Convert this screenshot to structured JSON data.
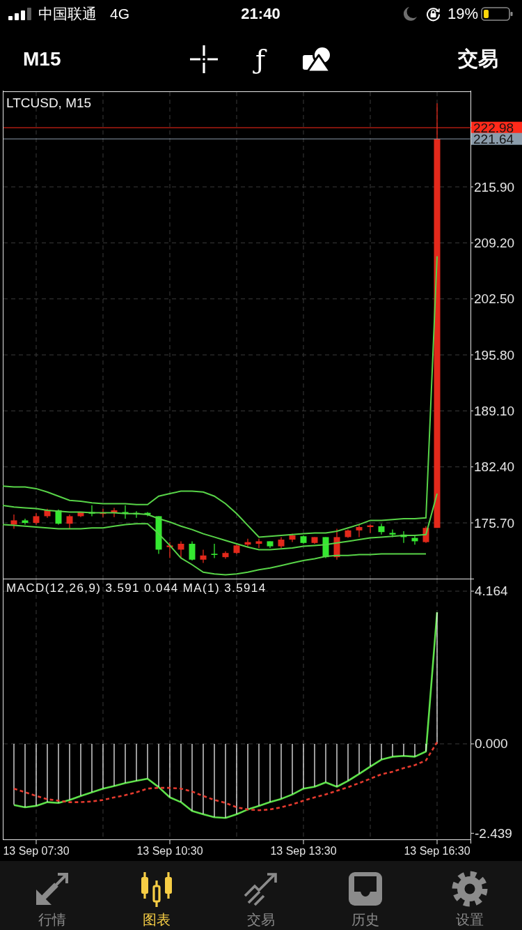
{
  "status_bar": {
    "carrier": "中国联通",
    "network": "4G",
    "time": "21:40",
    "battery_percent": "19%"
  },
  "toolbar": {
    "timeframe": "M15",
    "tools": [
      {
        "kind": "crosshair"
      },
      {
        "kind": "function",
        "glyph": "ƒ"
      },
      {
        "kind": "objects"
      }
    ],
    "trade": "交易"
  },
  "price_chart": {
    "chart_data": {
      "type": "candlestick",
      "title": "LTCUSD, M15",
      "categories": [
        null,
        null,
        null,
        null,
        null,
        null,
        null,
        null,
        null,
        null,
        null,
        null,
        null,
        null,
        null,
        null,
        null,
        null,
        null,
        null,
        null,
        null,
        null,
        null,
        null,
        null,
        null,
        null,
        null,
        null,
        null,
        null,
        null,
        null,
        null,
        null,
        null,
        null,
        null,
        null
      ],
      "ylim": [
        169.03,
        227.33
      ],
      "yticks": [
        {
          "value": 215.9,
          "label": "215.90"
        },
        {
          "value": 209.2,
          "label": "209.20"
        },
        {
          "value": 202.5,
          "label": "202.50"
        },
        {
          "value": 195.8,
          "label": "195.80"
        },
        {
          "value": 189.1,
          "label": "189.10"
        },
        {
          "value": 182.4,
          "label": "182.40"
        },
        {
          "value": 175.7,
          "label": "175.70"
        }
      ],
      "grid": true,
      "ohlc": [
        null,
        [
          175.5,
          176.7,
          175.0,
          176.0
        ],
        [
          176.0,
          176.2,
          175.5,
          175.7
        ],
        [
          175.7,
          176.9,
          175.5,
          176.5
        ],
        [
          176.5,
          177.4,
          176.3,
          177.2
        ],
        [
          177.2,
          177.3,
          175.5,
          175.6
        ],
        [
          175.6,
          176.7,
          175.0,
          176.5
        ],
        [
          176.5,
          177.0,
          176.4,
          177.0
        ],
        [
          177.0,
          177.8,
          176.5,
          176.8
        ],
        [
          176.8,
          177.4,
          176.4,
          176.9
        ],
        [
          176.9,
          177.5,
          176.4,
          177.2
        ],
        [
          177.0,
          177.8,
          176.2,
          176.8
        ],
        [
          176.9,
          177.1,
          176.3,
          176.7
        ],
        [
          176.9,
          177.0,
          176.5,
          176.7
        ],
        [
          176.5,
          176.5,
          172.0,
          172.5
        ],
        [
          172.8,
          173.4,
          171.5,
          173.0
        ],
        [
          172.5,
          173.5,
          171.5,
          173.2
        ],
        [
          173.2,
          173.5,
          171.2,
          171.3
        ],
        [
          171.3,
          172.5,
          170.9,
          171.8
        ],
        [
          172.0,
          173.2,
          171.5,
          171.9
        ],
        [
          171.6,
          172.3,
          171.4,
          172.1
        ],
        [
          172.1,
          173.1,
          172.0,
          173.0
        ],
        [
          173.1,
          173.8,
          172.8,
          173.4
        ],
        [
          173.2,
          173.8,
          172.7,
          173.5
        ],
        [
          173.5,
          173.5,
          172.7,
          172.9
        ],
        [
          172.9,
          174.0,
          172.7,
          173.7
        ],
        [
          173.7,
          174.4,
          173.4,
          174.2
        ],
        [
          174.1,
          174.2,
          173.2,
          173.3
        ],
        [
          173.3,
          174.0,
          173.2,
          174.0
        ],
        [
          174.0,
          174.0,
          171.5,
          171.6
        ],
        [
          171.6,
          175.0,
          171.3,
          174.0
        ],
        [
          174.0,
          174.9,
          173.9,
          174.8
        ],
        [
          174.8,
          175.5,
          174.0,
          175.2
        ],
        [
          175.2,
          175.5,
          174.5,
          175.4
        ],
        [
          175.3,
          175.6,
          174.3,
          174.6
        ],
        [
          174.5,
          174.9,
          174.0,
          174.3
        ],
        [
          174.3,
          174.7,
          173.3,
          174.0
        ],
        [
          173.9,
          174.2,
          173.1,
          173.5
        ],
        [
          173.4,
          175.3,
          173.3,
          175.1
        ],
        [
          175.1,
          225.9,
          175.1,
          221.64
        ]
      ],
      "ref_lines": [
        {
          "axis": "y",
          "value": 222.98,
          "label": "222.98",
          "color": "#ff2a1a"
        },
        {
          "axis": "y",
          "value": 221.64,
          "label": "221.64",
          "color": "#8b9cab"
        }
      ],
      "series": [
        {
          "type": "line",
          "color": "#58d448",
          "values": [
            180.1,
            180.0,
            180.0,
            179.8,
            179.4,
            178.9,
            178.4,
            178.3,
            178.1,
            178.0,
            178.0,
            178.0,
            177.9,
            177.9,
            178.9,
            179.2,
            179.5,
            179.5,
            179.4,
            178.9,
            178.0,
            176.8,
            175.4,
            174.0,
            174.1,
            174.2,
            174.3,
            174.4,
            174.5,
            174.5,
            174.7,
            175.1,
            175.5,
            176.0,
            176.0,
            176.1,
            176.2,
            176.2,
            176.3,
            207.6
          ]
        },
        {
          "type": "line",
          "color": "#58d448",
          "values": [
            177.8,
            177.6,
            177.5,
            177.4,
            177.2,
            177.1,
            177.0,
            177.0,
            176.9,
            176.9,
            176.9,
            176.8,
            176.8,
            176.7,
            176.2,
            175.8,
            175.3,
            174.9,
            174.4,
            174.0,
            173.6,
            173.2,
            172.8,
            172.5,
            172.5,
            172.6,
            172.7,
            172.9,
            173.0,
            173.1,
            173.3,
            173.5,
            173.7,
            173.9,
            174.0,
            174.1,
            174.2,
            174.2,
            174.3,
            179.2
          ]
        },
        {
          "type": "line",
          "color": "#58d448",
          "values": [
            175.5,
            175.4,
            175.3,
            175.2,
            175.1,
            175.0,
            175.0,
            175.0,
            175.1,
            175.1,
            175.3,
            175.5,
            175.6,
            175.6,
            174.4,
            173.0,
            171.5,
            170.7,
            169.8,
            169.6,
            169.5,
            169.6,
            169.8,
            170.1,
            170.3,
            170.6,
            170.9,
            171.2,
            171.4,
            171.7,
            171.8,
            171.8,
            171.9,
            171.9,
            172.0,
            172.0,
            172.0,
            172.0,
            172.0,
            null
          ]
        }
      ]
    }
  },
  "macd": {
    "chart_data": {
      "type": "line",
      "title": "MACD(12,26,9) 3.591 0.044 MA(1) 3.5914",
      "categories": [
        null,
        null,
        "13 Sep 07:30",
        null,
        null,
        null,
        null,
        null,
        null,
        null,
        null,
        null,
        null,
        null,
        "13 Sep 10:30",
        null,
        null,
        null,
        null,
        null,
        null,
        null,
        null,
        null,
        null,
        null,
        "13 Sep 13:30",
        null,
        null,
        null,
        null,
        null,
        null,
        null,
        null,
        null,
        null,
        null,
        "13 Sep 16:30"
      ],
      "ylim": [
        -2.605,
        4.506
      ],
      "yticks": [
        4.164,
        {
          "value": 0,
          "label": "0.000"
        },
        -2.439
      ],
      "grid": true,
      "series": [
        {
          "type": "bar",
          "color": "#ffffff",
          "values": [
            -1.67,
            -1.73,
            -1.69,
            -1.59,
            -1.61,
            -1.53,
            -1.42,
            -1.32,
            -1.22,
            -1.15,
            -1.07,
            -1.01,
            -0.95,
            -1.18,
            -1.46,
            -1.59,
            -1.83,
            -1.92,
            -2.0,
            -2.02,
            -1.92,
            -1.79,
            -1.69,
            -1.59,
            -1.5,
            -1.38,
            -1.22,
            -1.17,
            -1.05,
            -1.17,
            -1.01,
            -0.82,
            -0.62,
            -0.43,
            -0.35,
            -0.33,
            -0.35,
            -0.21,
            3.591
          ]
        },
        {
          "type": "line",
          "color": "#5ee04a",
          "values": [
            -1.67,
            -1.73,
            -1.69,
            -1.59,
            -1.61,
            -1.53,
            -1.42,
            -1.32,
            -1.22,
            -1.15,
            -1.07,
            -1.01,
            -0.95,
            -1.18,
            -1.46,
            -1.59,
            -1.83,
            -1.92,
            -2.0,
            -2.02,
            -1.92,
            -1.79,
            -1.69,
            -1.59,
            -1.5,
            -1.38,
            -1.22,
            -1.17,
            -1.05,
            -1.17,
            -1.01,
            -0.82,
            -0.62,
            -0.43,
            -0.35,
            -0.33,
            -0.35,
            -0.21,
            3.5914
          ]
        },
        {
          "color": "#e53a2e",
          "line_style": "dashed",
          "values": [
            -1.22,
            -1.32,
            -1.42,
            -1.51,
            -1.55,
            -1.59,
            -1.59,
            -1.57,
            -1.53,
            -1.46,
            -1.4,
            -1.32,
            -1.22,
            -1.2,
            -1.2,
            -1.22,
            -1.3,
            -1.42,
            -1.53,
            -1.61,
            -1.73,
            -1.79,
            -1.81,
            -1.79,
            -1.73,
            -1.65,
            -1.55,
            -1.46,
            -1.38,
            -1.28,
            -1.18,
            -1.07,
            -0.95,
            -0.83,
            -0.76,
            -0.66,
            -0.58,
            -0.45,
            0.044
          ]
        }
      ]
    }
  },
  "tab_bar": [
    {
      "kind": "quotes",
      "label": "行情",
      "selected": false
    },
    {
      "kind": "chart",
      "label": "图表",
      "selected": true
    },
    {
      "kind": "trade",
      "label": "交易",
      "selected": false
    },
    {
      "kind": "history",
      "label": "历史",
      "selected": false
    },
    {
      "kind": "settings",
      "label": "设置",
      "selected": false
    }
  ]
}
